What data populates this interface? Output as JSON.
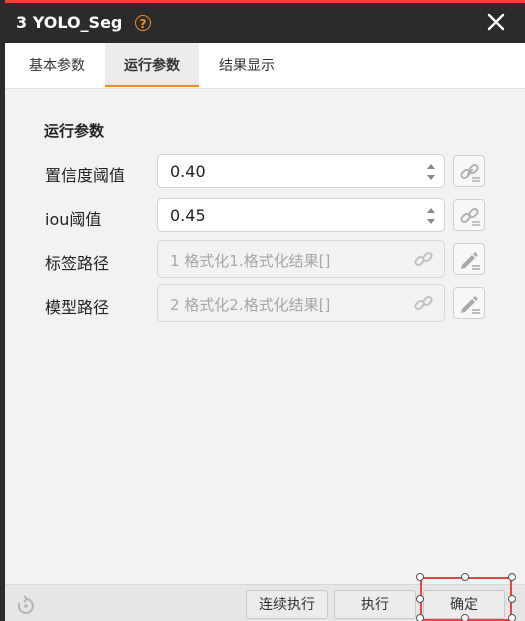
{
  "window": {
    "title": "3 YOLO_Seg"
  },
  "tabs": [
    {
      "label": "基本参数"
    },
    {
      "label": "运行参数"
    },
    {
      "label": "结果显示"
    }
  ],
  "section": {
    "title": "运行参数"
  },
  "params": [
    {
      "label": "置信度阈值",
      "value": "0.40"
    },
    {
      "label": "iou阈值",
      "value": "0.45"
    },
    {
      "label": "标签路径",
      "value": "1 格式化1.格式化结果[]"
    },
    {
      "label": "模型路径",
      "value": "2 格式化2.格式化结果[]"
    }
  ],
  "footer": {
    "continuous_label": "连续执行",
    "run_label": "执行",
    "ok_label": "确定"
  },
  "colors": {
    "accent": "#f08a24",
    "selection": "#e64545",
    "titlebar": "#2b2b2b"
  }
}
